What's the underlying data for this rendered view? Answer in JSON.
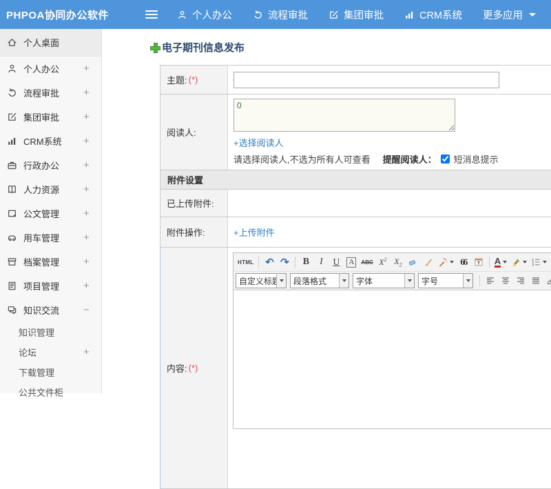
{
  "header": {
    "app_title": "PHPOA协同办公软件",
    "nav": [
      {
        "name": "personal-office",
        "label": "个人办公",
        "icon": "user-icon"
      },
      {
        "name": "workflow-approval",
        "label": "流程审批",
        "icon": "cycle-icon"
      },
      {
        "name": "group-approval",
        "label": "集团审批",
        "icon": "edit-icon"
      },
      {
        "name": "crm-system",
        "label": "CRM系统",
        "icon": "chart-icon"
      },
      {
        "name": "more-apps",
        "label": "更多应用",
        "caret": true
      }
    ]
  },
  "sidebar": {
    "items": [
      {
        "name": "personal-desktop",
        "label": "个人桌面",
        "icon": "home-icon",
        "active": true,
        "expand": ""
      },
      {
        "name": "personal-office",
        "label": "个人办公",
        "icon": "user-icon",
        "expand": "+"
      },
      {
        "name": "workflow-approval",
        "label": "流程审批",
        "icon": "cycle-icon",
        "expand": "+"
      },
      {
        "name": "group-approval",
        "label": "集团审批",
        "icon": "edit-icon",
        "expand": "+"
      },
      {
        "name": "crm-system",
        "label": "CRM系统",
        "icon": "chart-icon",
        "expand": "+"
      },
      {
        "name": "admin-office",
        "label": "行政办公",
        "icon": "briefcase-icon",
        "expand": "+"
      },
      {
        "name": "human-resources",
        "label": "人力资源",
        "icon": "book-icon",
        "expand": "+"
      },
      {
        "name": "document-mgmt",
        "label": "公文管理",
        "icon": "doc-icon",
        "expand": "+"
      },
      {
        "name": "vehicle-mgmt",
        "label": "用车管理",
        "icon": "car-icon",
        "expand": "+"
      },
      {
        "name": "archive-mgmt",
        "label": "档案管理",
        "icon": "archive-icon",
        "expand": "+"
      },
      {
        "name": "project-mgmt",
        "label": "项目管理",
        "icon": "notebook-icon",
        "expand": "+"
      },
      {
        "name": "knowledge-exchange",
        "label": "知识交流",
        "icon": "chat-icon",
        "expand": "−"
      },
      {
        "name": "knowledge-mgmt",
        "label": "知识管理",
        "sub": true,
        "expand": ""
      },
      {
        "name": "forum",
        "label": "论坛",
        "sub": true,
        "expand": "+"
      },
      {
        "name": "download-mgmt",
        "label": "下载管理",
        "sub": true,
        "expand": ""
      },
      {
        "name": "public-file-cabinet",
        "label": "公共文件柜",
        "sub": true,
        "expand": ""
      }
    ]
  },
  "main": {
    "page_title": "电子期刊信息发布",
    "form": {
      "subject_label": "主题:",
      "subject_required": "(*)",
      "subject_value": "",
      "readers_label": "阅读人:",
      "readers_value": "0",
      "select_readers_link": "+选择阅读人",
      "readers_hint": "请选择阅读人,不选为所有人可查看",
      "remind_readers_label": "提醒阅读人：",
      "sms_notice_label": "短消息提示",
      "sms_checked": true,
      "attachment_section_title": "附件设置",
      "uploaded_attachment_label": "已上传附件:",
      "uploaded_attachment_value": "",
      "attachment_action_label": "附件操作:",
      "upload_attachment_link": "+上传附件",
      "content_label": "内容:",
      "content_required": "(*)",
      "content_value": ""
    }
  },
  "editor": {
    "toolbar_row1": [
      {
        "type": "text",
        "name": "source-code-button",
        "label": "HTML",
        "cls": "html"
      },
      {
        "type": "sep"
      },
      {
        "type": "text",
        "name": "undo-button",
        "label": "↶",
        "cls": "undo"
      },
      {
        "type": "text",
        "name": "redo-button",
        "label": "↷",
        "cls": "redo"
      },
      {
        "type": "sep"
      },
      {
        "type": "text",
        "name": "bold-button",
        "label": "B",
        "cls": "bold"
      },
      {
        "type": "text",
        "name": "italic-button",
        "label": "I",
        "cls": "italic"
      },
      {
        "type": "text",
        "name": "underline-button",
        "label": "U",
        "cls": "underline"
      },
      {
        "type": "text",
        "name": "font-style-button",
        "label": "A",
        "cls": "boxed"
      },
      {
        "type": "text",
        "name": "strikethrough-button",
        "label": "ABC",
        "cls": "strike"
      },
      {
        "type": "supsub",
        "name": "superscript-button",
        "label": "X",
        "small": "2",
        "pos": "sup"
      },
      {
        "type": "supsub",
        "name": "subscript-button",
        "label": "X",
        "small": "2",
        "pos": "sub"
      },
      {
        "type": "icon",
        "name": "eraser-icon"
      },
      {
        "type": "icon",
        "name": "format-painter-icon"
      },
      {
        "type": "icon",
        "name": "quick-format-icon",
        "caret": true
      },
      {
        "type": "text",
        "name": "blockquote-button",
        "label": "66",
        "cls": "quote"
      },
      {
        "type": "icon",
        "name": "paste-as-text-icon"
      },
      {
        "type": "sep"
      },
      {
        "type": "text",
        "name": "font-color-button",
        "label": "A",
        "cls": "fontcolor",
        "caret": true
      },
      {
        "type": "icon",
        "name": "highlight-color-icon",
        "caret": true
      },
      {
        "type": "icon",
        "name": "ordered-list-icon",
        "caret": true
      },
      {
        "type": "icon",
        "name": "unordered-list-icon",
        "caret": true
      }
    ],
    "toolbar_row2": [
      {
        "type": "select",
        "name": "custom-title-select",
        "label": "自定义标题",
        "cls": "w1"
      },
      {
        "type": "select",
        "name": "paragraph-format-select",
        "label": "段落格式",
        "cls": "w2"
      },
      {
        "type": "select",
        "name": "font-family-select",
        "label": "字体",
        "cls": "w3"
      },
      {
        "type": "select",
        "name": "font-size-select",
        "label": "字号",
        "cls": "w4"
      },
      {
        "type": "sep"
      },
      {
        "type": "icon",
        "name": "align-left-icon"
      },
      {
        "type": "icon",
        "name": "align-center-icon"
      },
      {
        "type": "icon",
        "name": "align-right-icon"
      },
      {
        "type": "icon",
        "name": "justify-icon"
      },
      {
        "type": "icon",
        "name": "link-icon"
      },
      {
        "type": "icon",
        "name": "unlink-icon"
      },
      {
        "type": "icon",
        "name": "image-icon"
      },
      {
        "type": "icon",
        "name": "media-icon"
      }
    ]
  },
  "colors": {
    "header_bg": "#4f95dc",
    "link": "#2f81c5",
    "required": "#e05252",
    "title": "#2b4a6f",
    "plus_green": "#57b842"
  }
}
